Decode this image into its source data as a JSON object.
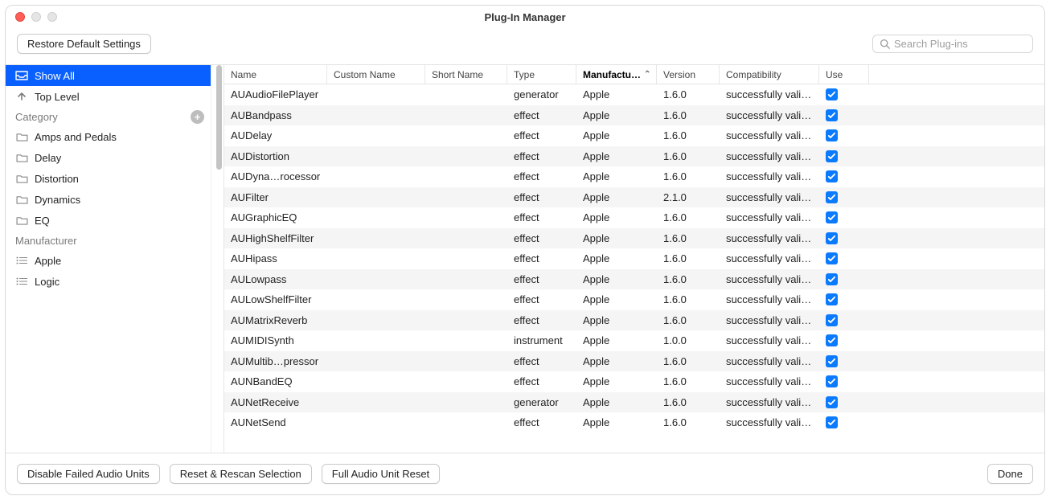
{
  "window": {
    "title": "Plug-In Manager"
  },
  "toolbar": {
    "restore": "Restore Default Settings",
    "search_placeholder": "Search Plug-ins"
  },
  "sidebar": {
    "show_all": "Show All",
    "top_level": "Top Level",
    "category_header": "Category",
    "categories": [
      "Amps and Pedals",
      "Delay",
      "Distortion",
      "Dynamics",
      "EQ"
    ],
    "manufacturer_header": "Manufacturer",
    "manufacturers": [
      "Apple",
      "Logic"
    ]
  },
  "table": {
    "headers": {
      "name": "Name",
      "custom": "Custom Name",
      "short": "Short Name",
      "type": "Type",
      "manufacturer": "Manufactu…",
      "version": "Version",
      "compatibility": "Compatibility",
      "use": "Use"
    },
    "rows": [
      {
        "name": "AUAudioFilePlayer",
        "type": "generator",
        "mfr": "Apple",
        "ver": "1.6.0",
        "comp": "successfully vali…",
        "use": true
      },
      {
        "name": "AUBandpass",
        "type": "effect",
        "mfr": "Apple",
        "ver": "1.6.0",
        "comp": "successfully vali…",
        "use": true
      },
      {
        "name": "AUDelay",
        "type": "effect",
        "mfr": "Apple",
        "ver": "1.6.0",
        "comp": "successfully vali…",
        "use": true
      },
      {
        "name": "AUDistortion",
        "type": "effect",
        "mfr": "Apple",
        "ver": "1.6.0",
        "comp": "successfully vali…",
        "use": true
      },
      {
        "name": "AUDyna…rocessor",
        "type": "effect",
        "mfr": "Apple",
        "ver": "1.6.0",
        "comp": "successfully vali…",
        "use": true
      },
      {
        "name": "AUFilter",
        "type": "effect",
        "mfr": "Apple",
        "ver": "2.1.0",
        "comp": "successfully vali…",
        "use": true
      },
      {
        "name": "AUGraphicEQ",
        "type": "effect",
        "mfr": "Apple",
        "ver": "1.6.0",
        "comp": "successfully vali…",
        "use": true
      },
      {
        "name": "AUHighShelfFilter",
        "type": "effect",
        "mfr": "Apple",
        "ver": "1.6.0",
        "comp": "successfully vali…",
        "use": true
      },
      {
        "name": "AUHipass",
        "type": "effect",
        "mfr": "Apple",
        "ver": "1.6.0",
        "comp": "successfully vali…",
        "use": true
      },
      {
        "name": "AULowpass",
        "type": "effect",
        "mfr": "Apple",
        "ver": "1.6.0",
        "comp": "successfully vali…",
        "use": true
      },
      {
        "name": "AULowShelfFilter",
        "type": "effect",
        "mfr": "Apple",
        "ver": "1.6.0",
        "comp": "successfully vali…",
        "use": true
      },
      {
        "name": "AUMatrixReverb",
        "type": "effect",
        "mfr": "Apple",
        "ver": "1.6.0",
        "comp": "successfully vali…",
        "use": true
      },
      {
        "name": "AUMIDISynth",
        "type": "instrument",
        "mfr": "Apple",
        "ver": "1.0.0",
        "comp": "successfully vali…",
        "use": true
      },
      {
        "name": "AUMultib…pressor",
        "type": "effect",
        "mfr": "Apple",
        "ver": "1.6.0",
        "comp": "successfully vali…",
        "use": true
      },
      {
        "name": "AUNBandEQ",
        "type": "effect",
        "mfr": "Apple",
        "ver": "1.6.0",
        "comp": "successfully vali…",
        "use": true
      },
      {
        "name": "AUNetReceive",
        "type": "generator",
        "mfr": "Apple",
        "ver": "1.6.0",
        "comp": "successfully vali…",
        "use": true
      },
      {
        "name": "AUNetSend",
        "type": "effect",
        "mfr": "Apple",
        "ver": "1.6.0",
        "comp": "successfully vali…",
        "use": true
      }
    ]
  },
  "footer": {
    "disable": "Disable Failed Audio Units",
    "reset_rescan": "Reset & Rescan Selection",
    "full_reset": "Full Audio Unit Reset",
    "done": "Done"
  }
}
